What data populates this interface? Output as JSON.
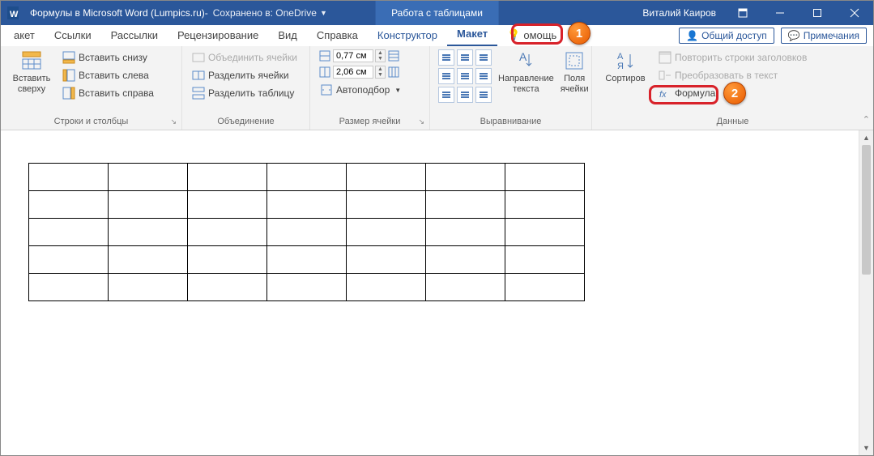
{
  "titlebar": {
    "doc_title": "Формулы в Microsoft Word (Lumpics.ru)",
    "separator": " - ",
    "saved_in": "Сохранено в: OneDrive",
    "context_title": "Работа с таблицами",
    "user_name": "Виталий Каиров"
  },
  "tabs": {
    "maket_cut": "акет",
    "links": "Ссылки",
    "mailings": "Рассылки",
    "review": "Рецензирование",
    "view": "Вид",
    "help": "Справка",
    "design": "Конструктор",
    "layout": "Макет",
    "tell_me": "омощь",
    "share": "Общий доступ",
    "comments": "Примечания"
  },
  "ribbon": {
    "rows_cols": {
      "insert_above_big": "Вставить\nсверху",
      "insert_below": "Вставить снизу",
      "insert_left": "Вставить слева",
      "insert_right": "Вставить справа",
      "group_label": "Строки и столбцы"
    },
    "merge": {
      "merge_cells": "Объединить ячейки",
      "split_cells": "Разделить ячейки",
      "split_table": "Разделить таблицу",
      "group_label": "Объединение"
    },
    "cell_size": {
      "height_val": "0,77 см",
      "width_val": "2,06 см",
      "autofit": "Автоподбор",
      "group_label": "Размер ячейки"
    },
    "alignment": {
      "text_direction": "Направление\nтекста",
      "cell_margins": "Поля\nячейки",
      "group_label": "Выравнивание"
    },
    "data": {
      "sort": "Сортиров",
      "repeat_header": "Повторить строки заголовков",
      "convert_text": "Преобразовать в текст",
      "formula": "Формула",
      "group_label": "Данные"
    }
  },
  "callouts": {
    "one": "1",
    "two": "2"
  },
  "table": {
    "rows": 5,
    "cols": 7
  }
}
